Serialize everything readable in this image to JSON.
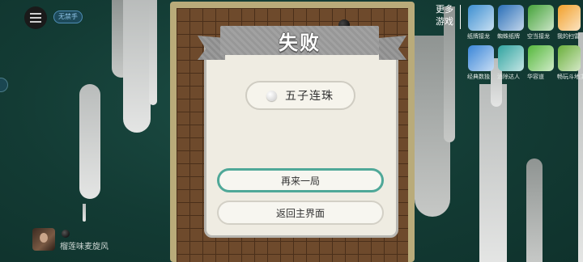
{
  "top_left": {
    "no_foul_badge": "无禁手"
  },
  "player": {
    "name": "榴莲味麦旋风"
  },
  "dialog": {
    "title": "失败",
    "mode_label": "五子连珠",
    "play_again": "再来一局",
    "back_home": "返回主界面"
  },
  "more_games": {
    "label": "更多游戏",
    "items": [
      {
        "label": "纸牌接龙",
        "icon": "solitaire-icon",
        "color": "#3d8fd1"
      },
      {
        "label": "蜘蛛纸牌",
        "icon": "spider-solitaire-icon",
        "color": "#2a6fb8"
      },
      {
        "label": "空当接龙",
        "icon": "freecell-icon",
        "color": "#46a33a"
      },
      {
        "label": "我的扫雷",
        "icon": "minesweeper-icon",
        "color": "#f2a02a"
      },
      {
        "label": "经典数独",
        "icon": "sudoku-icon",
        "color": "#3a86d8"
      },
      {
        "label": "消除达人",
        "icon": "match-icon",
        "color": "#30a4a0"
      },
      {
        "label": "华容道",
        "icon": "klotski-icon",
        "color": "#56b83c"
      },
      {
        "label": "畅玩斗地主",
        "icon": "doudizhu-icon",
        "color": "#6aaf3a"
      }
    ]
  }
}
